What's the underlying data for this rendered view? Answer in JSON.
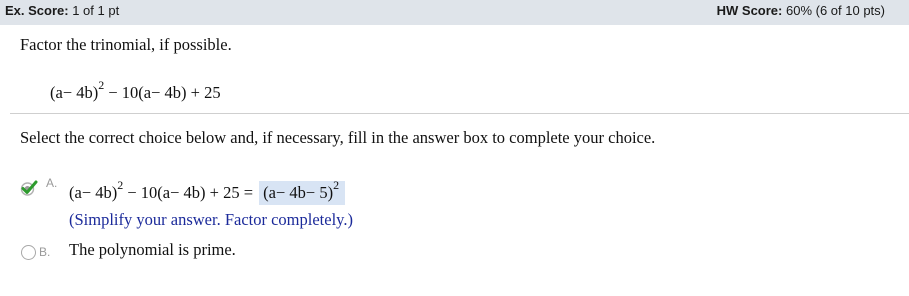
{
  "score_bar": {
    "ex_score_label": "Ex. Score:",
    "ex_score_value": "1 of 1 pt",
    "hw_score_label": "HW Score:",
    "hw_score_value": "60% (6 of 10 pts)"
  },
  "question": {
    "prompt": "Factor the trinomial, if possible.",
    "expression": {
      "base": "(a− 4b)",
      "exponent": "2",
      "rest": "− 10(a− 4b) + 25"
    },
    "instruction": "Select the correct choice below and, if necessary, fill in the answer box to complete your choice."
  },
  "choices": {
    "a": {
      "letter": "A.",
      "selected": true,
      "correct": true,
      "lhs_base": "(a− 4b)",
      "lhs_exponent": "2",
      "lhs_rest": "− 10(a− 4b) + 25 =",
      "answer_base": "(a− 4b− 5)",
      "answer_exponent": "2",
      "hint": "(Simplify your answer. Factor completely.)"
    },
    "b": {
      "letter": "B.",
      "selected": false,
      "text": "The polynomial is prime."
    }
  },
  "colors": {
    "score_bar_bg": "#dfe4ea",
    "answer_box_bg": "#d8e4f4",
    "hint_text": "#1b2a9a",
    "checkmark": "#2e9b2e"
  }
}
